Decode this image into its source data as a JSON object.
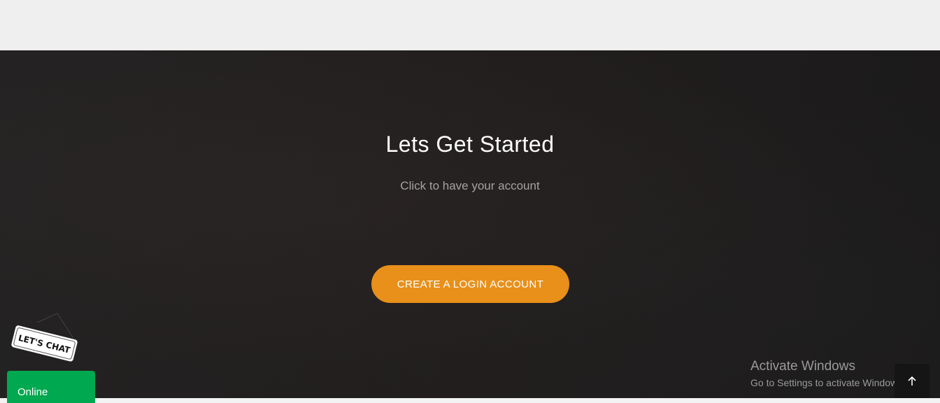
{
  "hero": {
    "title": "Lets Get Started",
    "subtitle": "Click to have your account",
    "cta_label": "CREATE A LOGIN ACCOUNT"
  },
  "chat_widget": {
    "badge_text": "LET'S CHAT",
    "status_label": "Online"
  },
  "watermark": {
    "title": "Activate Windows",
    "subtitle": "Go to Settings to activate Windows."
  },
  "colors": {
    "cta": "#e8901a",
    "online": "#00a84f",
    "hero_bg": "#221e1e"
  },
  "icons": {
    "scroll_top": "arrow-up-icon"
  }
}
